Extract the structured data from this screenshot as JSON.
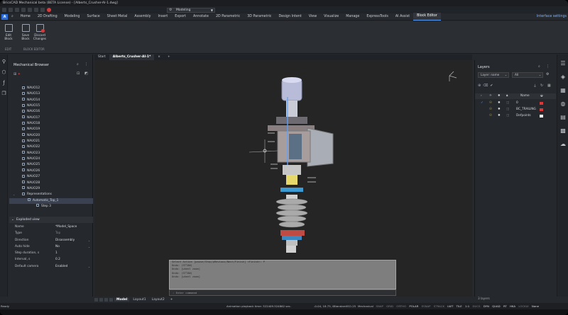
{
  "titlebar": {
    "text": "BricsCAD Mechanical beta (BETA License) - [Alberts_Crusher-AI-1.dwg]"
  },
  "quick_access": {
    "workspace": "Modeling"
  },
  "ribbon_tabs": [
    {
      "label": "Home"
    },
    {
      "label": "2D Drafting"
    },
    {
      "label": "Modeling"
    },
    {
      "label": "Surface"
    },
    {
      "label": "Sheet Metal"
    },
    {
      "label": "Assembly"
    },
    {
      "label": "Insert"
    },
    {
      "label": "Export"
    },
    {
      "label": "Annotate"
    },
    {
      "label": "2D Parametric"
    },
    {
      "label": "3D Parametric"
    },
    {
      "label": "Design Intent"
    },
    {
      "label": "View"
    },
    {
      "label": "Visualize"
    },
    {
      "label": "Manage"
    },
    {
      "label": "ExpressTools"
    },
    {
      "label": "AI Assist"
    },
    {
      "label": "Block Editor"
    }
  ],
  "interface_settings": "Interface settings",
  "ribbon": {
    "buttons": [
      {
        "label": "Edit Block"
      },
      {
        "label": "Save Block"
      },
      {
        "label": "Discard Changes"
      }
    ],
    "group_edit": "EDIT",
    "group_block": "BLOCK EDITOR"
  },
  "mechanical_browser": {
    "title": "Mechanical Browser",
    "nodes": [
      {
        "label": "NAUO12"
      },
      {
        "label": "NAUO13"
      },
      {
        "label": "NAUO14"
      },
      {
        "label": "NAUO15"
      },
      {
        "label": "NAUO16"
      },
      {
        "label": "NAUO17"
      },
      {
        "label": "NAUO18"
      },
      {
        "label": "NAUO19"
      },
      {
        "label": "NAUO20"
      },
      {
        "label": "NAUO21"
      },
      {
        "label": "NAUO22"
      },
      {
        "label": "NAUO23"
      },
      {
        "label": "NAUO24"
      },
      {
        "label": "NAUO25"
      },
      {
        "label": "NAUO26"
      },
      {
        "label": "NAUO27"
      },
      {
        "label": "NAUO28"
      },
      {
        "label": "NAUO29"
      }
    ],
    "representations": "Representations",
    "automatic_top": "Automatic_Top_1",
    "step": "Step 3"
  },
  "properties": {
    "section": "Exploded view",
    "rows": [
      {
        "key": "Name",
        "value": "*Model_Space"
      },
      {
        "key": "Type",
        "value": "Top"
      },
      {
        "key": "Direction",
        "value": "Disassembly"
      },
      {
        "key": "Auto hide",
        "value": "No"
      },
      {
        "key": "Step duration, s",
        "value": "1"
      },
      {
        "key": "Interval, s",
        "value": "0.2"
      },
      {
        "key": "Default camera",
        "value": "Enabled"
      }
    ]
  },
  "doc_tabs": [
    {
      "label": "Start"
    },
    {
      "label": "Alberts_Crusher-AI-1*"
    }
  ],
  "command": {
    "lines": [
      "Select Action [pause/Stop/pRevious/Next/Finish] <Finish>: P",
      "Undo: (STTAN)",
      "Undo: [wheel zoom]",
      "Undo: (STTAN)",
      "Undo: [wheel zoom]"
    ],
    "prompt": ": Enter command"
  },
  "layout_tabs": [
    {
      "label": "Model"
    },
    {
      "label": "Layout1"
    },
    {
      "label": "Layout2"
    }
  ],
  "status": {
    "ready": "Ready",
    "message": "Animation playback time: 322409.524862 sec.",
    "coords": "-0.04, 18.75, 0",
    "standard": "Standard",
    "iso": "ISO-25",
    "mode": "Mechanical",
    "toggles": [
      {
        "label": "SNAP"
      },
      {
        "label": "GRID"
      },
      {
        "label": "ORTHO"
      },
      {
        "label": "POLAR"
      },
      {
        "label": "ESNAP"
      },
      {
        "label": "STRACK"
      },
      {
        "label": "LWT"
      },
      {
        "label": "TILE"
      },
      {
        "label": "1:1"
      },
      {
        "label": "DUCS"
      },
      {
        "label": "DYN"
      },
      {
        "label": "QUAD"
      },
      {
        "label": "RT"
      },
      {
        "label": "HKA"
      },
      {
        "label": "LOCKUI"
      },
      {
        "label": "None"
      }
    ]
  },
  "layers": {
    "title": "Layers",
    "filter_select": "Layer: name",
    "state_select": "All",
    "column_name": "Name",
    "rows": [
      {
        "name": "0",
        "color": "#d63a3a"
      },
      {
        "name": "BC_TRAILING",
        "color": "#d63a3a"
      },
      {
        "name": "Defpoints",
        "color": "#ffffff"
      }
    ],
    "count": "3 layers"
  },
  "colors": {
    "accent": "#5a9ff5",
    "app_blue": "#2d6bd6",
    "red": "#d63a3a"
  }
}
